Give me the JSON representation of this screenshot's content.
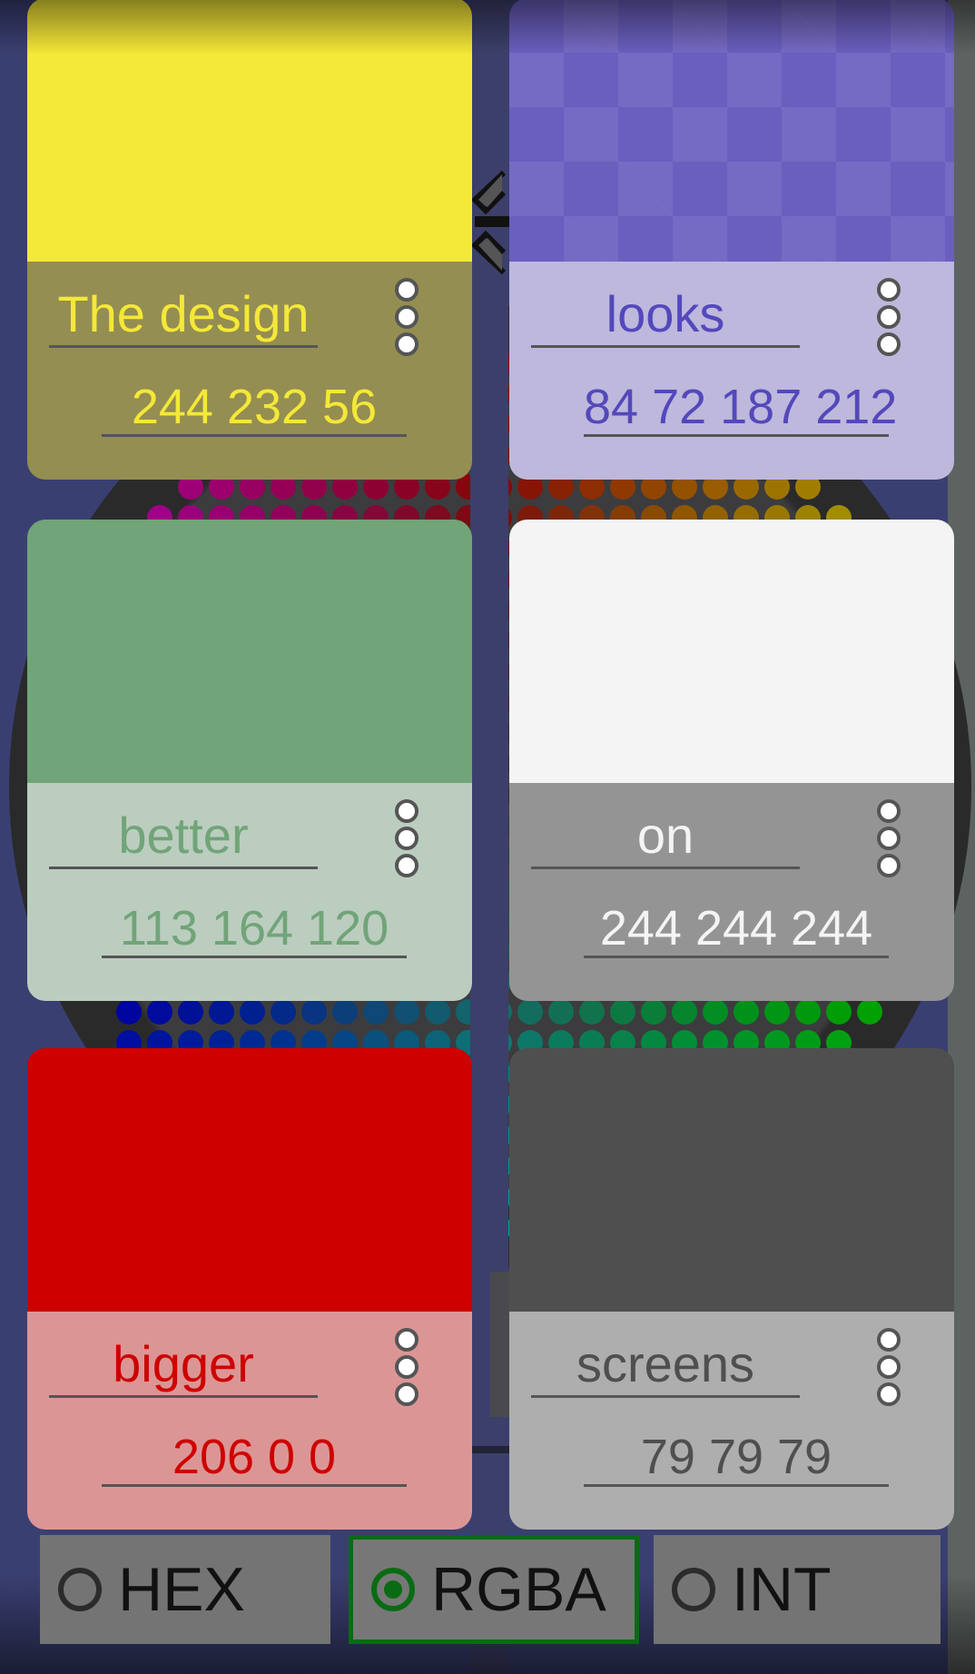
{
  "colors": [
    {
      "name": "The design",
      "values": "244 232 56",
      "swatch": "#f4e838",
      "info_bg": "#948e52",
      "text": "#f4e838"
    },
    {
      "name": "looks",
      "values": "84 72 187 212",
      "swatch": "#6a5fbf",
      "info_bg": "#bdb8dc",
      "text": "#5448bb"
    },
    {
      "name": "better",
      "values": "113 164 120",
      "swatch": "#71a478",
      "info_bg": "#bbcdbf",
      "text": "#71a478"
    },
    {
      "name": "on",
      "values": "244 244 244",
      "swatch": "#f4f4f4",
      "info_bg": "#949494",
      "text": "#f4f4f4"
    },
    {
      "name": "bigger",
      "values": "206 0 0",
      "swatch": "#ce0000",
      "info_bg": "#dc9595",
      "text": "#ce0000"
    },
    {
      "name": "screens",
      "values": "79 79 79",
      "swatch": "#4f4f4f",
      "info_bg": "#aeaeae",
      "text": "#4f4f4f"
    }
  ],
  "format": {
    "options": [
      {
        "label": "HEX",
        "checked": false
      },
      {
        "label": "RGBA",
        "checked": true
      },
      {
        "label": "INT",
        "checked": false
      }
    ]
  },
  "icons": [
    "collapse-arrows-icon",
    "more-vert-icon",
    "radio-icon"
  ]
}
